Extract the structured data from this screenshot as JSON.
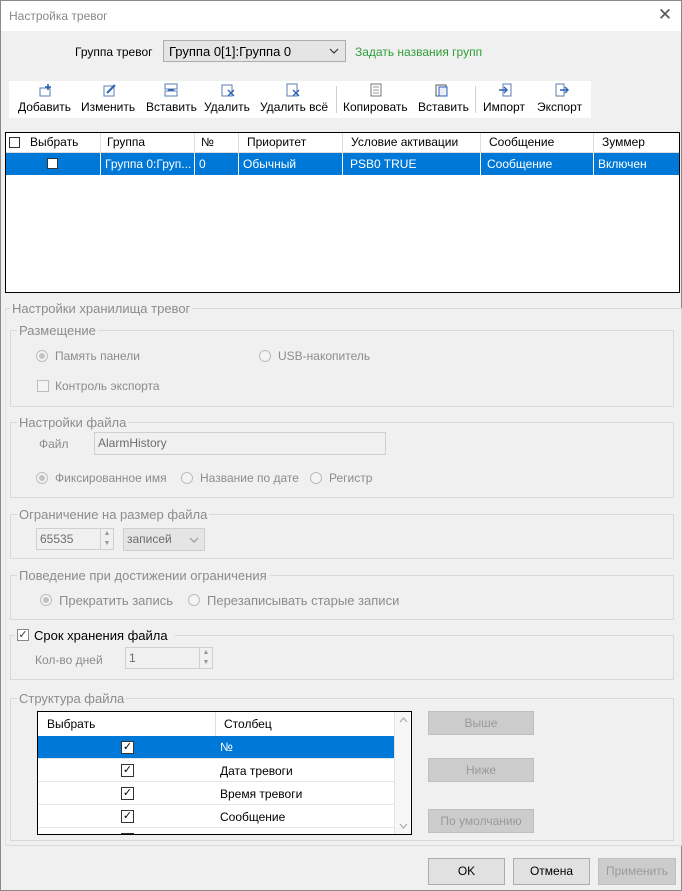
{
  "window": {
    "title": "Настройка тревог",
    "close_icon": "close-icon"
  },
  "group": {
    "label": "Группа тревог",
    "selected": "Группа 0[1]:Группа 0",
    "link": "Задать названия групп"
  },
  "toolbar": {
    "items": [
      {
        "label": "Добавить",
        "icon": "add-icon"
      },
      {
        "label": "Изменить",
        "icon": "edit-icon"
      },
      {
        "label": "Вставить",
        "icon": "insert-icon"
      },
      {
        "label": "Удалить",
        "icon": "delete-icon"
      },
      {
        "label": "Удалить всё",
        "icon": "delete-all-icon"
      },
      {
        "label": "Копировать",
        "icon": "copy-icon"
      },
      {
        "label": "Вставить",
        "icon": "paste-icon"
      },
      {
        "label": "Импорт",
        "icon": "import-icon"
      },
      {
        "label": "Экспорт",
        "icon": "export-icon"
      }
    ]
  },
  "alarm_table": {
    "headers": [
      "Выбрать",
      "Группа",
      "№",
      "Приоритет",
      "Условие активации",
      "Сообщение",
      "Зуммер"
    ],
    "rows": [
      [
        "",
        "Группа 0:Груп...",
        "0",
        "Обычный",
        "PSB0 TRUE",
        "Сообщение",
        "Включен"
      ]
    ]
  },
  "storage": {
    "title": "Настройки хранилища тревог",
    "placement": {
      "title": "Размещение",
      "panel_memory": "Память панели",
      "usb": "USB-накопитель",
      "export_control": "Контроль экспорта"
    },
    "file_settings": {
      "title": "Настройки файла",
      "file_label": "Файл",
      "file_value": "AlarmHistory",
      "fixed_name": "Фиксированное имя",
      "by_date": "Название по дате",
      "register": "Регистр"
    },
    "size_limit": {
      "title": "Ограничение на размер файла",
      "value": "65535",
      "unit": "записей"
    },
    "on_limit": {
      "title": "Поведение при достижении ограничения",
      "stop": "Прекратить запись",
      "overwrite": "Перезаписывать старые записи"
    },
    "retention": {
      "title": "Срок хранения файла",
      "days_label": "Кол-во дней",
      "days_value": "1"
    },
    "structure": {
      "title": "Структура файла",
      "headers": [
        "Выбрать",
        "Столбец"
      ],
      "rows": [
        "№",
        "Дата тревоги",
        "Время тревоги",
        "Сообщение"
      ],
      "up": "Выше",
      "down": "Ниже",
      "default": "По умолчанию"
    }
  },
  "footer": {
    "ok": "OK",
    "cancel": "Отмена",
    "apply": "Применить"
  },
  "colors": {
    "selection": "#0078d7",
    "link": "#2e9f3a"
  }
}
